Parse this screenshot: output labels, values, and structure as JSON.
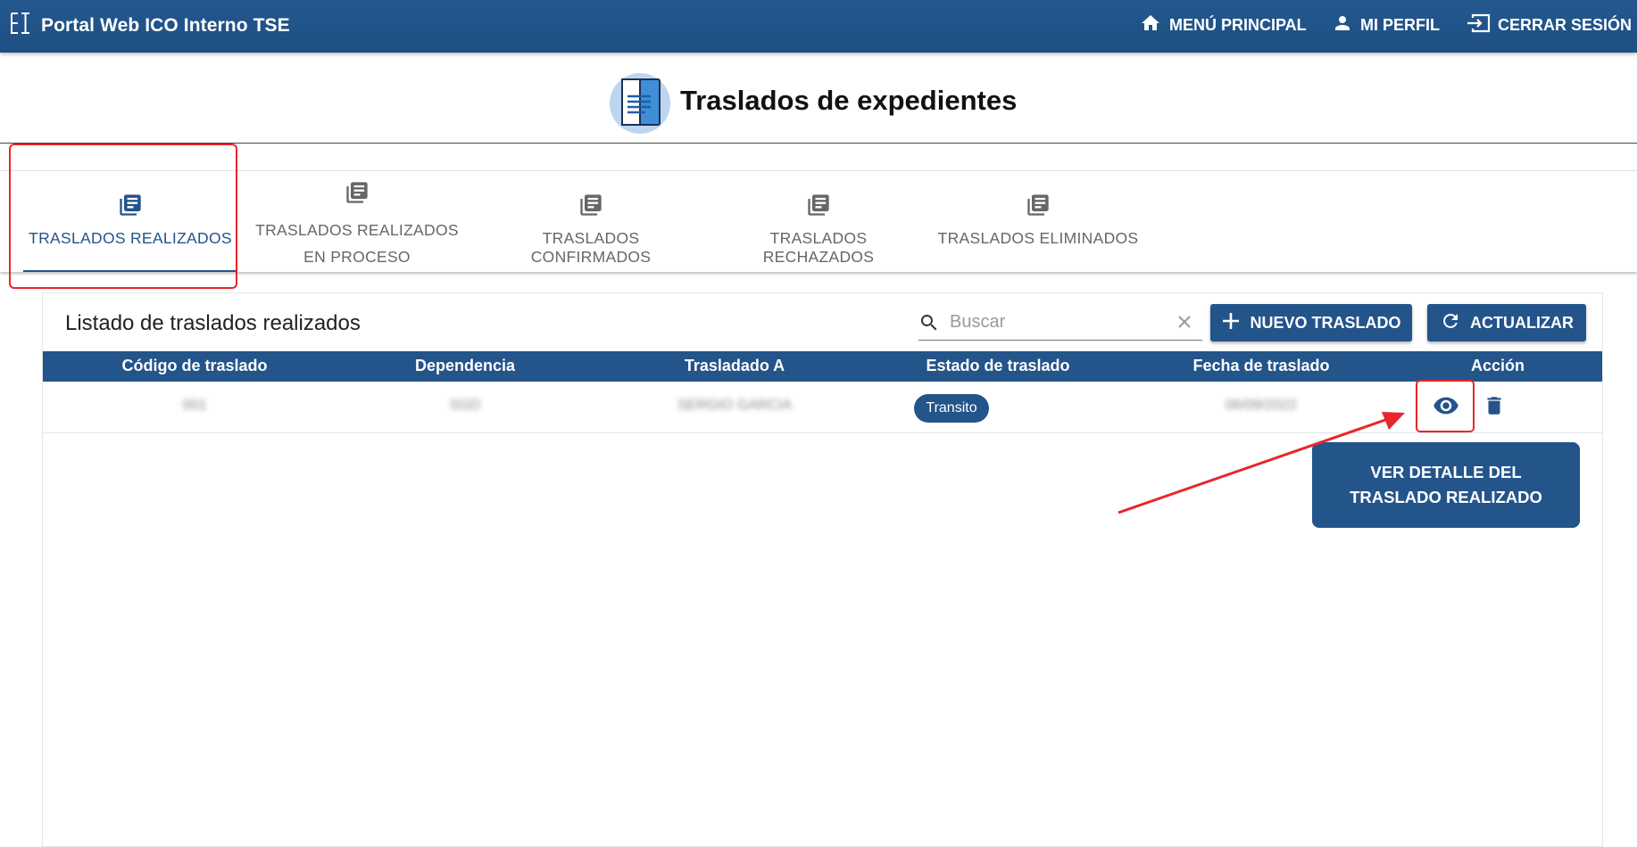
{
  "app": {
    "title": "Portal Web ICO Interno TSE"
  },
  "topnav": {
    "menu_principal": "MENÚ PRINCIPAL",
    "mi_perfil": "MI PERFIL",
    "cerrar_sesion": "CERRAR SESIÓN"
  },
  "page": {
    "title": "Traslados de expedientes"
  },
  "tabs": [
    {
      "label": "TRASLADOS REALIZADOS",
      "active": true
    },
    {
      "label_line1": "TRASLADOS REALIZADOS",
      "label_line2": "EN PROCESO",
      "active": false
    },
    {
      "label": "TRASLADOS CONFIRMADOS",
      "active": false
    },
    {
      "label": "TRASLADOS RECHAZADOS",
      "active": false
    },
    {
      "label": "TRASLADOS ELIMINADOS",
      "active": false
    }
  ],
  "list": {
    "title": "Listado de traslados realizados",
    "search_placeholder": "Buscar",
    "new_button": "NUEVO TRASLADO",
    "refresh_button": "ACTUALIZAR",
    "columns": [
      "Código de traslado",
      "Dependencia",
      "Trasladado A",
      "Estado de traslado",
      "Fecha de traslado",
      "Acción"
    ],
    "rows": [
      {
        "codigo": "001",
        "dependencia": "SGD",
        "trasladado_a": "SERGIO GARCIA",
        "estado": "Transito",
        "fecha": "06/09/2022"
      }
    ]
  },
  "annotation": {
    "line1": "VER DETALLE DEL",
    "line2": "TRASLADO REALIZADO"
  },
  "colors": {
    "primary": "#23548a",
    "highlight": "#e8262b"
  }
}
